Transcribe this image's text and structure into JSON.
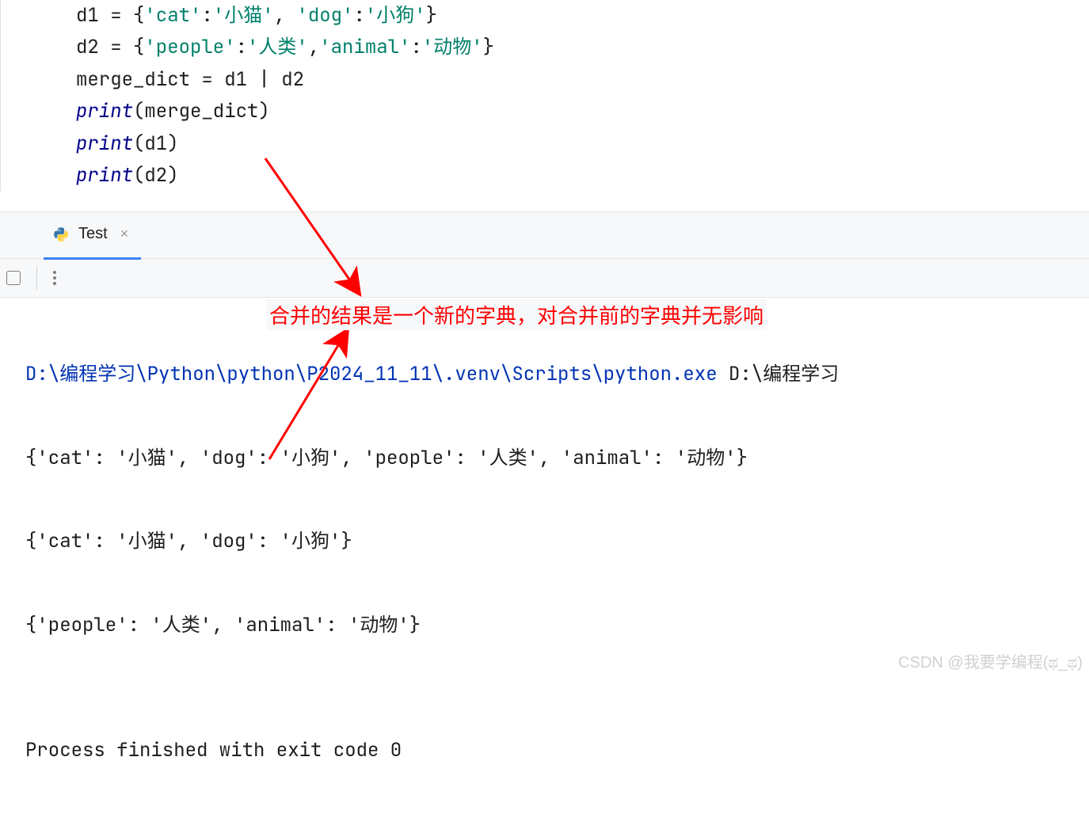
{
  "code": {
    "line1": {
      "p1": "d1 = {",
      "s1": "'cat'",
      "c1": ":",
      "s2": "'小猫'",
      "c2": ", ",
      "s3": "'dog'",
      "c3": ":",
      "s4": "'小狗'",
      "p2": "}"
    },
    "line2": {
      "p1": "d2 = {",
      "s1": "'people'",
      "c1": ":",
      "s2": "'人类'",
      "c2": ",",
      "s3": "'animal'",
      "c3": ":",
      "s4": "'动物'",
      "p2": "}"
    },
    "line3": "merge_dict = d1 | d2",
    "line4": {
      "fn": "print",
      "arg": "(merge_dict)"
    },
    "line5": {
      "fn": "print",
      "arg": "(d1)"
    },
    "line6": {
      "fn": "print",
      "arg": "(d2)"
    }
  },
  "tab": {
    "label": "Test"
  },
  "annotation": "合并的结果是一个新的字典，对合并前的字典并无影响",
  "console": {
    "line1a": "D:\\编程学习\\Python\\python\\P2024_11_11\\.venv\\Scripts\\python.exe",
    "line1b": " D:\\编程学习",
    "line2": "{'cat': '小猫', 'dog': '小狗', 'people': '人类', 'animal': '动物'}",
    "line3": "{'cat': '小猫', 'dog': '小狗'}",
    "line4": "{'people': '人类', 'animal': '动物'}",
    "line5": "",
    "line6": "Process finished with exit code 0"
  },
  "watermark": "CSDN @我要学编程(ಥ_ಥ)"
}
